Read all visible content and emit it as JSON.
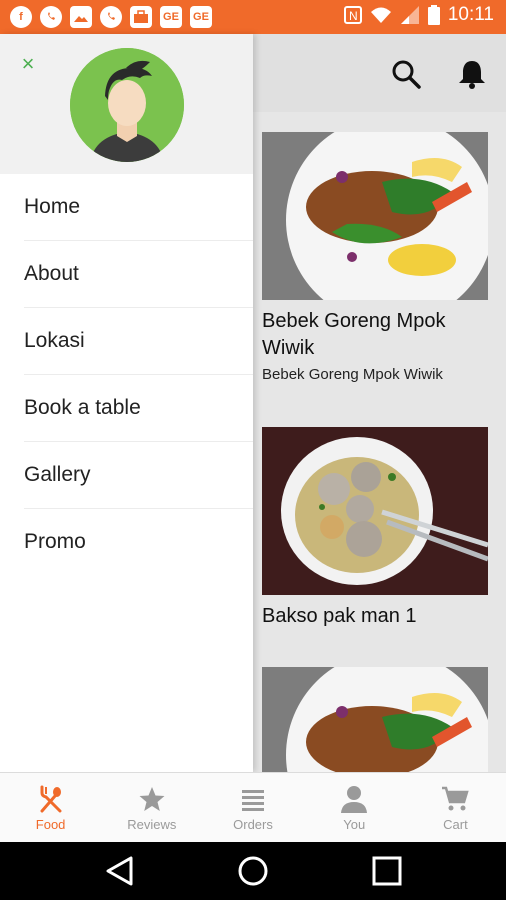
{
  "status_bar": {
    "time": "10:11",
    "notification_icons": [
      "facebook-icon",
      "whatsapp-icon",
      "gallery-icon",
      "whatsapp-icon",
      "briefcase-icon",
      "ge-icon",
      "ge-icon"
    ],
    "ge_label": "GE",
    "accent": "#f06a2a"
  },
  "drawer": {
    "menu_items": [
      "Home",
      "About",
      "Lokasi",
      "Book a table",
      "Gallery",
      "Promo"
    ],
    "avatar_bg": "#7bc24e",
    "close_color": "#4caf50"
  },
  "cards": [
    {
      "title": "Bebek Goreng Mpok Wiwik",
      "subtitle": "Bebek Goreng Mpok Wiwik"
    },
    {
      "title": "Bakso pak man 1",
      "subtitle": ""
    }
  ],
  "bottom_nav": [
    {
      "label": "Food",
      "icon": "fork-spoon-icon",
      "active": true
    },
    {
      "label": "Reviews",
      "icon": "star-icon",
      "active": false
    },
    {
      "label": "Orders",
      "icon": "list-icon",
      "active": false
    },
    {
      "label": "You",
      "icon": "person-icon",
      "active": false
    },
    {
      "label": "Cart",
      "icon": "cart-icon",
      "active": false
    }
  ]
}
